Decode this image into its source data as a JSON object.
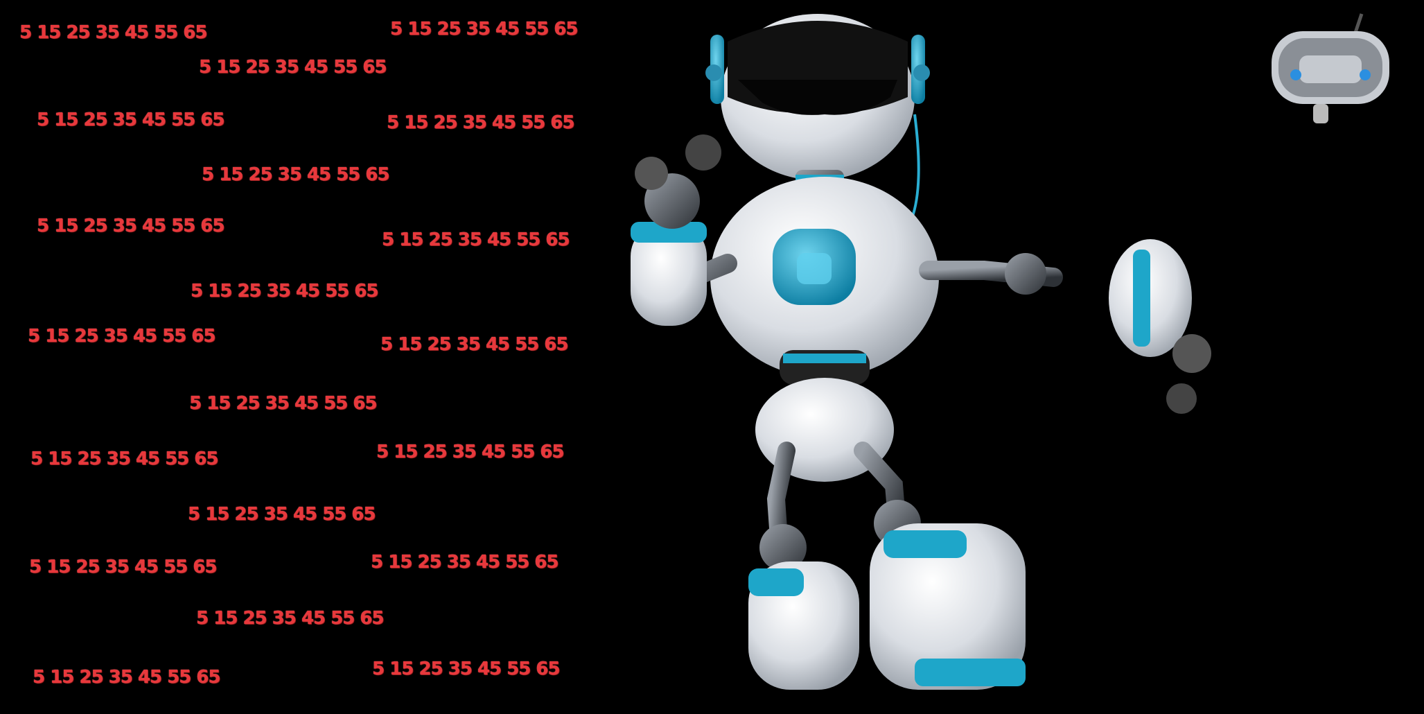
{
  "number_lines": [
    "5 15 25 35 45 55 65",
    "5 15 25 35 45 55 65",
    "5 15 25 35 45 55 65",
    "5 15 25 35 45 55 65",
    "5 15 25 35 45 55 65",
    "5 15 25 35 45 55 65",
    "5 15 25 35 45 55 65",
    "5 15 25 35 45 55 65",
    "5 15 25 35 45 55 65",
    "5 15 25 35 45 55 65",
    "5 15 25 35 45 55 65",
    "5 15 25 35 45 55 65",
    "5 15 25 35 45 55 65",
    "5 15 25 35 45 55 65",
    "5 15 25 35 45 55 65",
    "5 15 25 35 45 55 65",
    "5 15 25 35 45 55 65",
    "5 15 25 35 45 55 65",
    "5 15 25 35 45 55 65",
    "5 15 25 35 45 55 65"
  ],
  "colors": {
    "background": "#000000",
    "number_text": "#e8383c",
    "robot_body": "#e6e9ee",
    "robot_accent": "#1ea6c9",
    "robot_joint": "#4a4f55"
  },
  "illustration": {
    "main": "humanoid-robot-with-vr-headset",
    "secondary": "small-robot-head-with-antenna"
  }
}
